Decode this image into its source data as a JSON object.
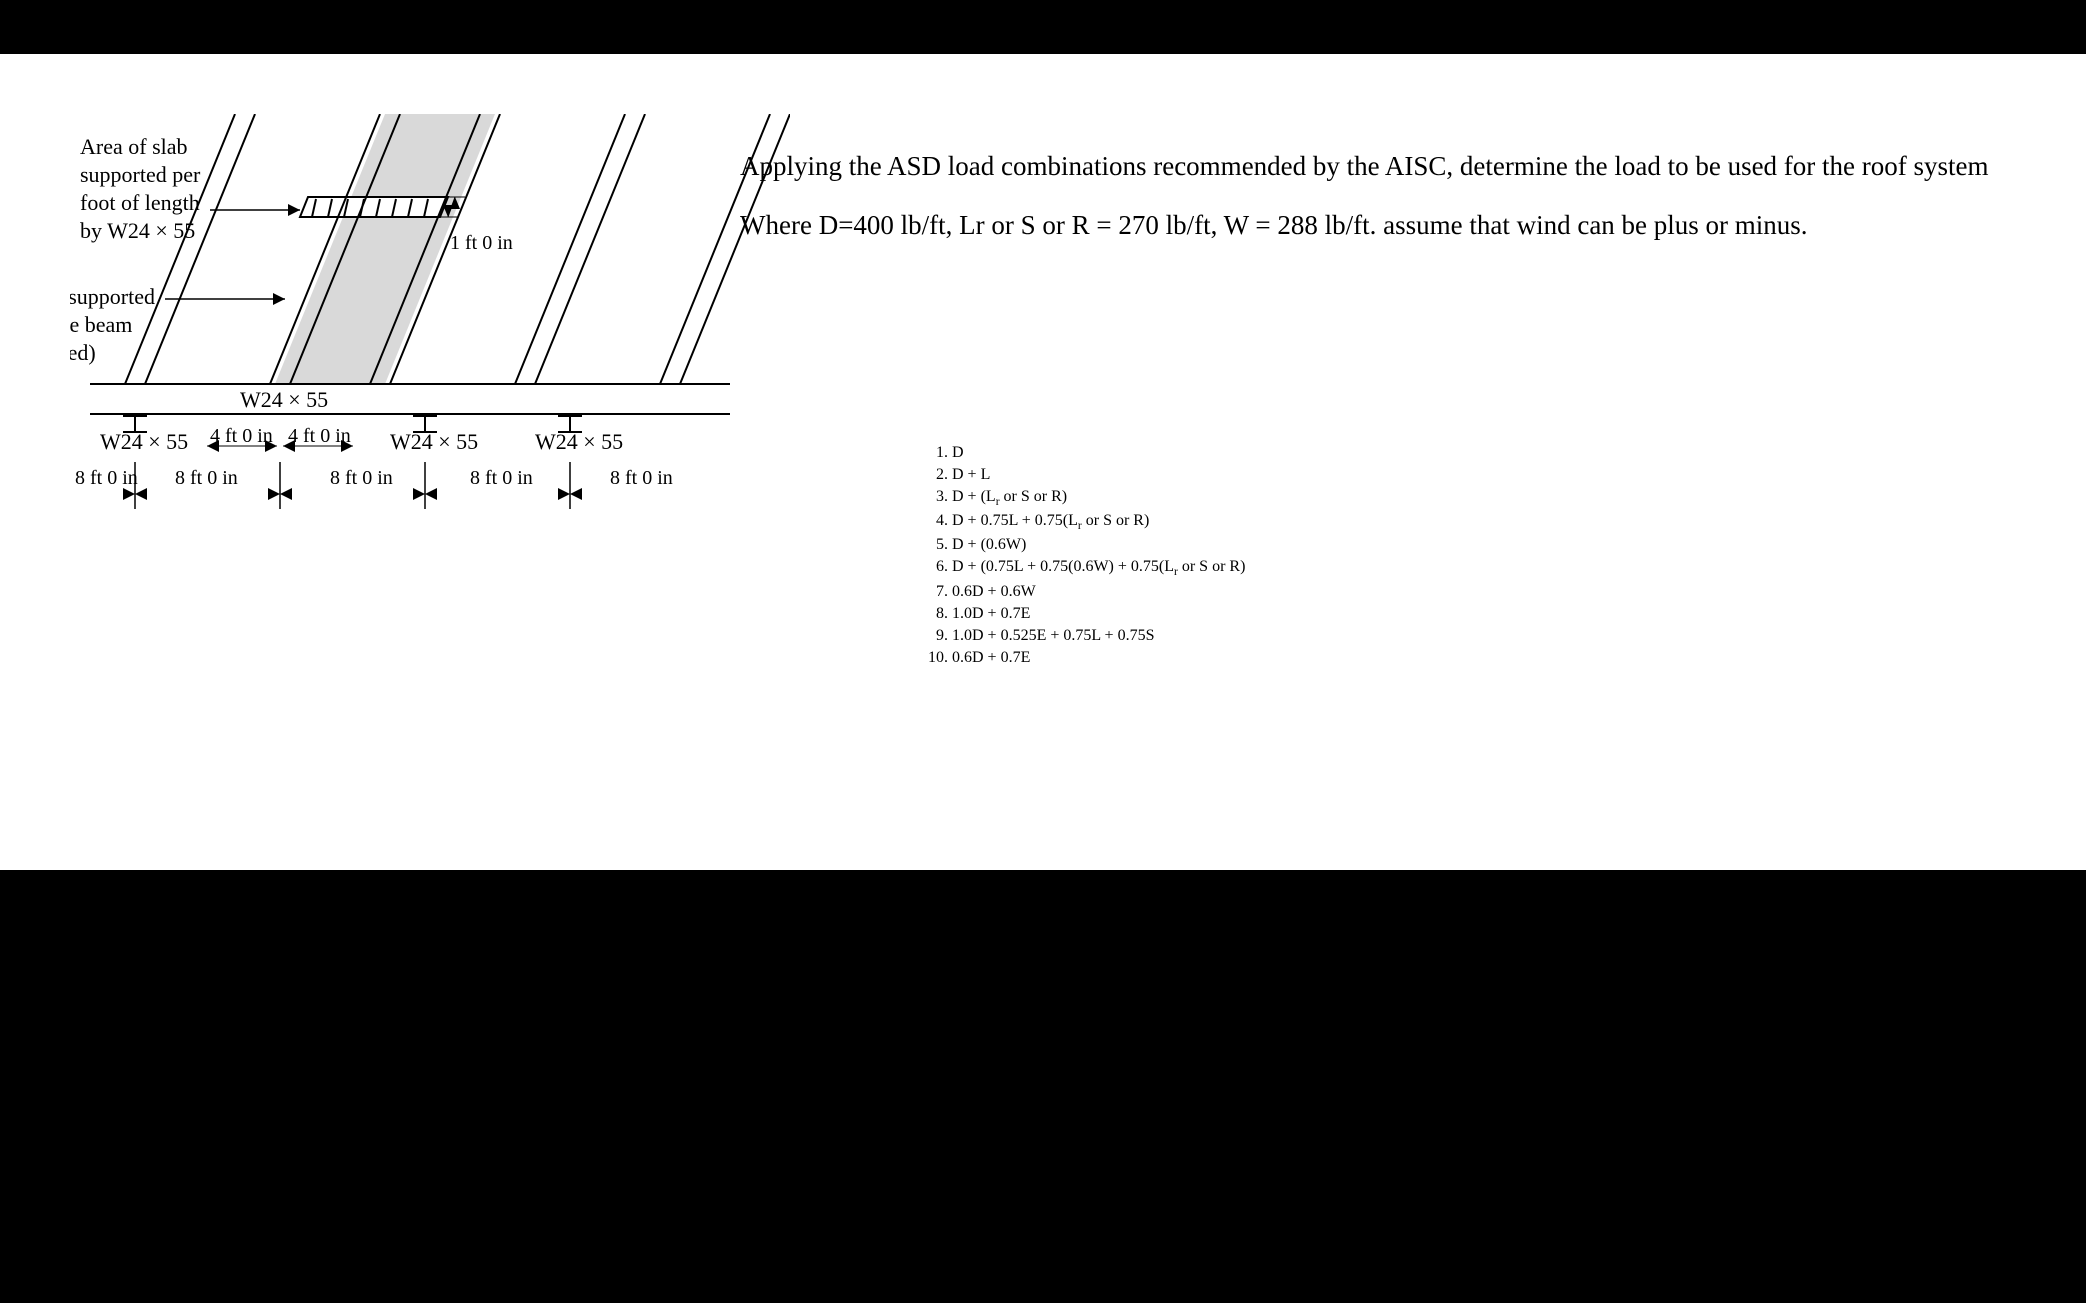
{
  "figure": {
    "label_area_of_slab_l1": "Area of slab",
    "label_area_of_slab_l2": "supported per",
    "label_area_of_slab_l3": "foot of length",
    "label_area_of_slab_l4": "by W24 × 55",
    "label_area_supported_l1": "Area supported",
    "label_area_supported_l2": "by one beam",
    "label_area_supported_l3": "(shaded)",
    "dim_1ft": "1 ft 0 in",
    "beam_girder": "W24 × 55",
    "beam_label_1": "W24 × 55",
    "beam_label_2": "W24 × 55",
    "beam_label_3": "W24 × 55",
    "trib_half_left": "4 ft 0 in",
    "trib_half_right": "4 ft 0 in",
    "span_1": "8 ft 0 in",
    "span_2": "8 ft 0 in",
    "span_3": "8 ft 0 in",
    "span_4": "8 ft 0 in",
    "span_5": "8 ft 0 in"
  },
  "prose": {
    "p1": "Applying the ASD load combinations recommended by the AISC, determine the load to be used for the roof system",
    "p2": "Where D=400 lb/ft, Lr or S or R = 270 lb/ft, W = 288 lb/ft. assume that wind can be plus or minus."
  },
  "combos": {
    "c1": "D",
    "c2": "D + L",
    "c3a": "D + (L",
    "c3b": " or S or R)",
    "c4a": "D + 0.75L + 0.75(L",
    "c4b": " or S or R)",
    "c5": "D + (0.6W)",
    "c6a": "D + (0.75L + 0.75(0.6W) + 0.75(L",
    "c6b": " or S or R)",
    "c7": "0.6D + 0.6W",
    "c8": "1.0D + 0.7E",
    "c9": "1.0D + 0.525E + 0.75L + 0.75S",
    "c10": "0.6D + 0.7E"
  }
}
